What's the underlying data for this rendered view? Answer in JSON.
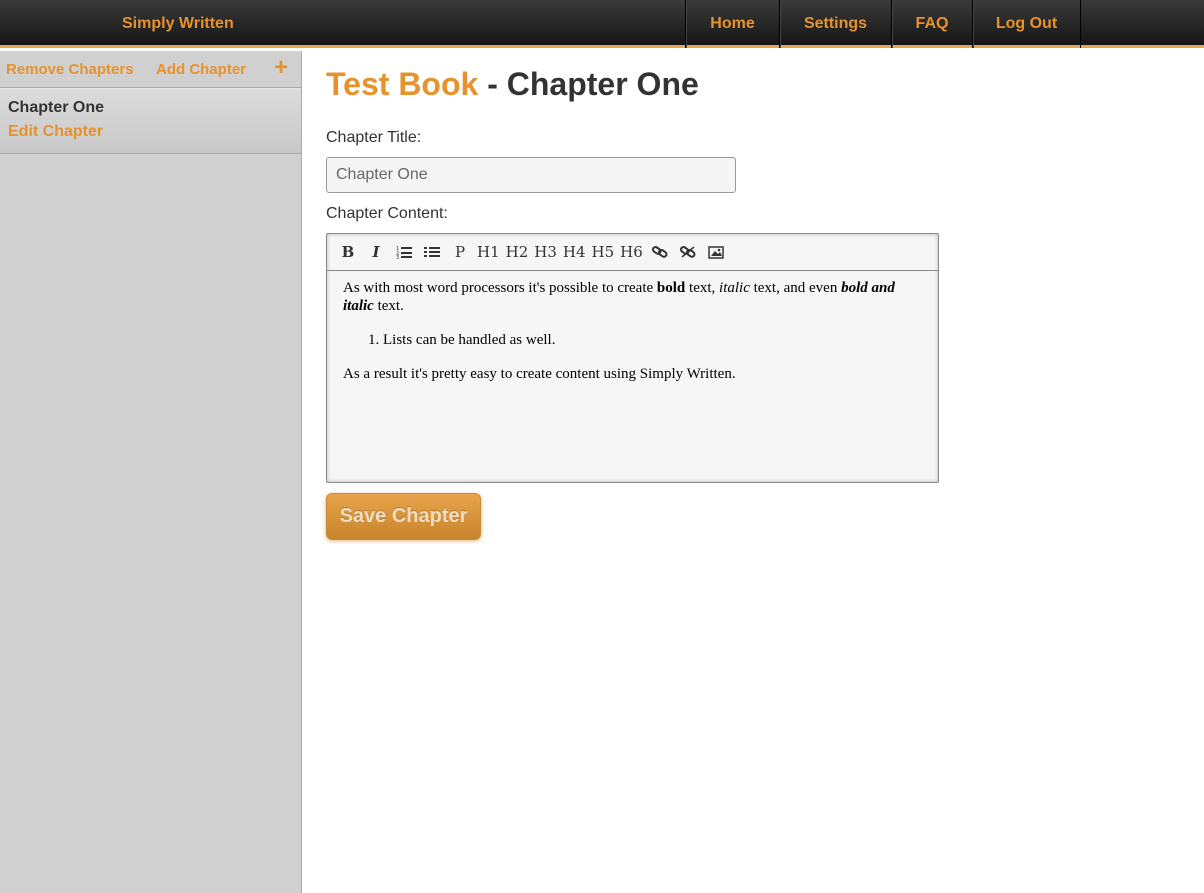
{
  "app": {
    "brand": "Simply Written"
  },
  "nav": {
    "home": "Home",
    "settings": "Settings",
    "faq": "FAQ",
    "logout": "Log Out"
  },
  "sidebar": {
    "remove_label": "Remove Chapters",
    "add_label": "Add Chapter",
    "plus_glyph": "+",
    "chapters": [
      {
        "name": "Chapter One",
        "edit_label": "Edit Chapter"
      }
    ]
  },
  "page": {
    "book_title": "Test Book",
    "separator": " - ",
    "chapter_title": "Chapter One"
  },
  "form": {
    "title_label": "Chapter Title:",
    "title_value": "Chapter One",
    "content_label": "Chapter Content:",
    "save_label": "Save Chapter"
  },
  "toolbar": {
    "bold": "B",
    "italic": "I",
    "paragraph": "P",
    "h1": "H1",
    "h2": "H2",
    "h3": "H3",
    "h4": "H4",
    "h5": "H5",
    "h6": "H6",
    "icons": [
      "ordered-list-icon",
      "unordered-list-icon",
      "link-icon",
      "unlink-icon",
      "image-icon"
    ]
  },
  "content": {
    "p1_a": "As with most word processors it's possible to create ",
    "p1_bold": "bold",
    "p1_b": " text, ",
    "p1_italic": "italic",
    "p1_c": " text, and even ",
    "p1_bolditalic": "bold and italic",
    "p1_d": " text.",
    "list_item": "Lists can be handled as well.",
    "p2": "As a result it's pretty easy to create content using Simply Written."
  },
  "colors": {
    "accent": "#e8922e",
    "topbar": "#1c1c1c",
    "sidebar": "#d0d0d0"
  }
}
